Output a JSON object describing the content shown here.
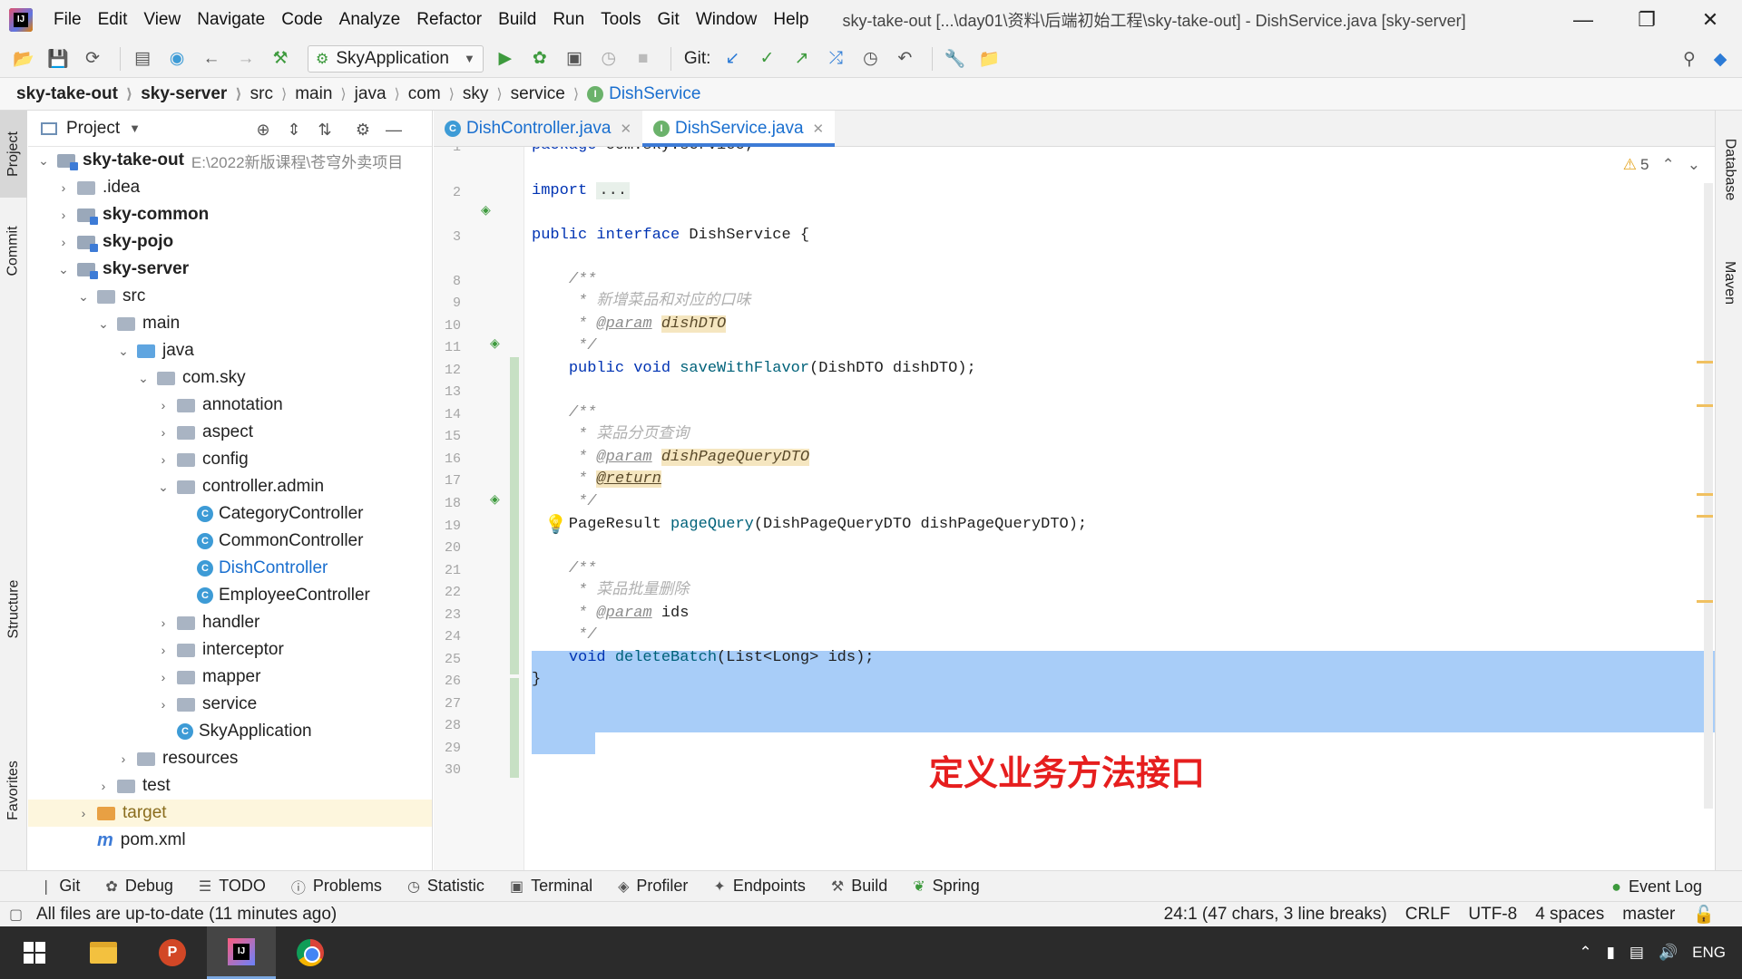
{
  "titlebar": {
    "menu": [
      "File",
      "Edit",
      "View",
      "Navigate",
      "Code",
      "Analyze",
      "Refactor",
      "Build",
      "Run",
      "Tools",
      "Git",
      "Window",
      "Help"
    ],
    "window_title": "sky-take-out [...\\day01\\资料\\后端初始工程\\sky-take-out] - DishService.java [sky-server]"
  },
  "toolbar": {
    "run_config": "SkyApplication",
    "git_label": "Git:"
  },
  "breadcrumb": [
    "sky-take-out",
    "sky-server",
    "src",
    "main",
    "java",
    "com",
    "sky",
    "service",
    "DishService"
  ],
  "left_strip": {
    "project": "Project",
    "commit": "Commit",
    "structure": "Structure",
    "favorites": "Favorites"
  },
  "right_strip": {
    "database": "Database",
    "maven": "Maven"
  },
  "project_panel": {
    "title": "Project",
    "root_path": "E:\\2022新版课程\\苍穹外卖项目",
    "tree": [
      {
        "label": "sky-take-out",
        "depth": 0,
        "chev": "v",
        "kind": "module",
        "bold": true
      },
      {
        "label": ".idea",
        "depth": 1,
        "chev": ">",
        "kind": "folder"
      },
      {
        "label": "sky-common",
        "depth": 1,
        "chev": ">",
        "kind": "module",
        "bold": true
      },
      {
        "label": "sky-pojo",
        "depth": 1,
        "chev": ">",
        "kind": "module",
        "bold": true
      },
      {
        "label": "sky-server",
        "depth": 1,
        "chev": "v",
        "kind": "module",
        "bold": true
      },
      {
        "label": "src",
        "depth": 2,
        "chev": "v",
        "kind": "folder"
      },
      {
        "label": "main",
        "depth": 3,
        "chev": "v",
        "kind": "folder"
      },
      {
        "label": "java",
        "depth": 4,
        "chev": "v",
        "kind": "src"
      },
      {
        "label": "com.sky",
        "depth": 5,
        "chev": "v",
        "kind": "folder"
      },
      {
        "label": "annotation",
        "depth": 6,
        "chev": ">",
        "kind": "folder"
      },
      {
        "label": "aspect",
        "depth": 6,
        "chev": ">",
        "kind": "folder"
      },
      {
        "label": "config",
        "depth": 6,
        "chev": ">",
        "kind": "folder"
      },
      {
        "label": "controller.admin",
        "depth": 6,
        "chev": "v",
        "kind": "folder"
      },
      {
        "label": "CategoryController",
        "depth": 7,
        "chev": "",
        "kind": "class"
      },
      {
        "label": "CommonController",
        "depth": 7,
        "chev": "",
        "kind": "class"
      },
      {
        "label": "DishController",
        "depth": 7,
        "chev": "",
        "kind": "class",
        "selected": true
      },
      {
        "label": "EmployeeController",
        "depth": 7,
        "chev": "",
        "kind": "class"
      },
      {
        "label": "handler",
        "depth": 6,
        "chev": ">",
        "kind": "folder"
      },
      {
        "label": "interceptor",
        "depth": 6,
        "chev": ">",
        "kind": "folder"
      },
      {
        "label": "mapper",
        "depth": 6,
        "chev": ">",
        "kind": "folder"
      },
      {
        "label": "service",
        "depth": 6,
        "chev": ">",
        "kind": "folder"
      },
      {
        "label": "SkyApplication",
        "depth": 6,
        "chev": "",
        "kind": "class"
      },
      {
        "label": "resources",
        "depth": 4,
        "chev": ">",
        "kind": "folder"
      },
      {
        "label": "test",
        "depth": 3,
        "chev": ">",
        "kind": "folder"
      },
      {
        "label": "target",
        "depth": 2,
        "chev": ">",
        "kind": "orange"
      },
      {
        "label": "pom.xml",
        "depth": 2,
        "chev": "",
        "kind": "maven"
      }
    ]
  },
  "editor_tabs": [
    {
      "label": "DishController.java",
      "icon": "C",
      "active": false
    },
    {
      "label": "DishService.java",
      "icon": "I",
      "active": true
    }
  ],
  "editor": {
    "warning_count": "5",
    "line_numbers": [
      "1",
      "2",
      "3",
      "8",
      "9",
      "10",
      "11",
      "12",
      "13",
      "14",
      "15",
      "16",
      "17",
      "18",
      "19",
      "20",
      "21",
      "22",
      "23",
      "24",
      "25",
      "26",
      "27",
      "28",
      "29",
      "30"
    ],
    "annotation": "定义业务方法接口"
  },
  "bottom_tabs": [
    "Git",
    "Debug",
    "TODO",
    "Problems",
    "Statistic",
    "Terminal",
    "Profiler",
    "Endpoints",
    "Build",
    "Spring"
  ],
  "event_log": "Event Log",
  "statusbar": {
    "message": "All files are up-to-date (11 minutes ago)",
    "position": "24:1 (47 chars, 3 line breaks)",
    "line_sep": "CRLF",
    "encoding": "UTF-8",
    "indent": "4 spaces",
    "branch": "master"
  },
  "taskbar": {
    "lang": "ENG"
  }
}
